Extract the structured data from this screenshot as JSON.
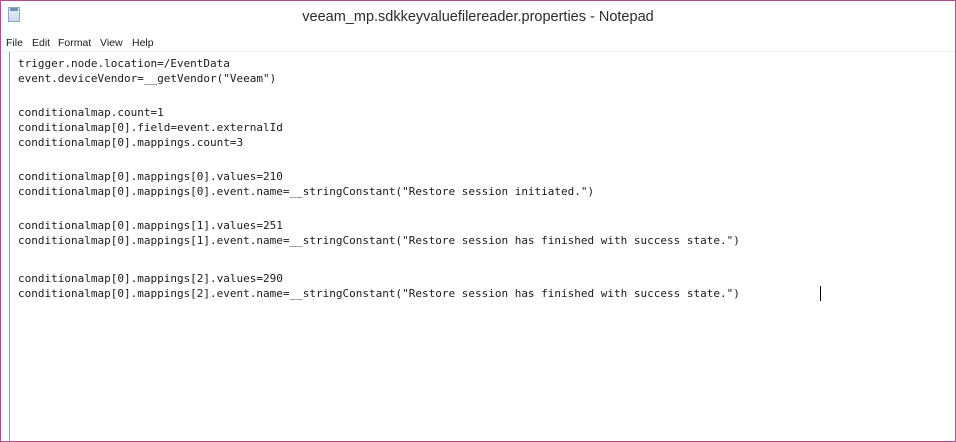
{
  "window": {
    "title": "veeam_mp.sdkkeyvaluefilereader.properties - Notepad",
    "icon": "notepad-icon"
  },
  "menu": {
    "file": "File",
    "edit": "Edit",
    "format": "Format",
    "view": "View",
    "help": "Help"
  },
  "editor": {
    "lines": [
      "trigger.node.location=/EventData",
      "event.deviceVendor=__getVendor(\"Veeam\")",
      "",
      "conditionalmap.count=1",
      "conditionalmap[0].field=event.externalId",
      "conditionalmap[0].mappings.count=3",
      "",
      "conditionalmap[0].mappings[0].values=210",
      "conditionalmap[0].mappings[0].event.name=__stringConstant(\"Restore session initiated.\")",
      "",
      "conditionalmap[0].mappings[1].values=251",
      "conditionalmap[0].mappings[1].event.name=__stringConstant(\"Restore session has finished with success state.\")",
      "",
      "conditionalmap[0].mappings[2].values=290",
      "conditionalmap[0].mappings[2].event.name=__stringConstant(\"Restore session has finished with success state.\")"
    ]
  }
}
